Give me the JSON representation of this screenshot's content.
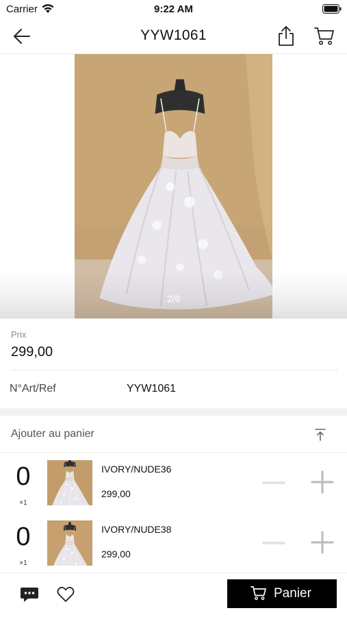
{
  "status_bar": {
    "carrier": "Carrier",
    "time": "9:22 AM",
    "icons": [
      "wifi-icon",
      "battery-icon"
    ]
  },
  "nav": {
    "title": "YYW1061",
    "icons": [
      "back-arrow-icon",
      "share-icon",
      "cart-icon"
    ]
  },
  "gallery": {
    "counter": "2/6",
    "current_index": 2,
    "total": 6
  },
  "product": {
    "price_label": "Prix",
    "price": "299,00",
    "ref_label": "N°Art/Ref",
    "ref_value": "YYW1061"
  },
  "cart_section": {
    "title": "Ajouter au panier",
    "icon": "scroll-to-top-icon",
    "variants": [
      {
        "quantity": "0",
        "multiplier": "×1",
        "name": "IVORY/NUDE36",
        "price": "299,00"
      },
      {
        "quantity": "0",
        "multiplier": "×1",
        "name": "IVORY/NUDE38",
        "price": "299,00"
      }
    ]
  },
  "bottom_bar": {
    "icons": [
      "chat-icon",
      "heart-icon"
    ],
    "cart_button_label": "Panier"
  },
  "colors": {
    "background": "#f1f1f1",
    "button": "#000000",
    "muted_text": "#8a8a8a",
    "stepper_disabled": "#e4e4e4",
    "stepper_plus": "#bdbdbd"
  }
}
